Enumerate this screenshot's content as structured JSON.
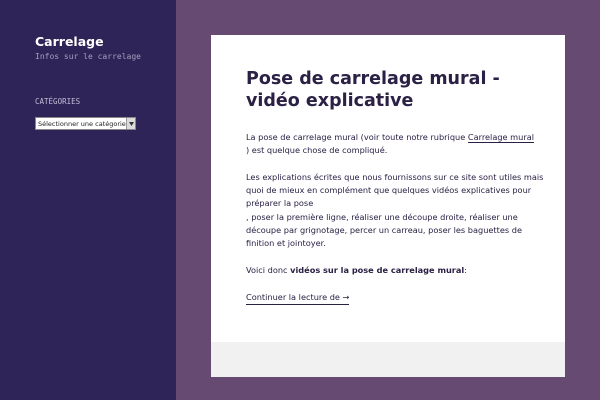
{
  "sidebar": {
    "site_title": "Carrelage",
    "site_description": "Infos sur le carrelage",
    "widget_title": "CATÉGORIES",
    "category_select_value": "Sélectionner une catégorie"
  },
  "article": {
    "title": "Pose de carrelage mural - vidéo explicative",
    "p1_before_link": "La pose de carrelage mural (voir toute notre rubrique ",
    "p1_link": "Carrelage mural",
    "p1_after_link": ") est quelque chose de compliqué.",
    "p2_line1": "Les explications écrites que nous fournissons sur ce site sont utiles mais quoi de mieux en complément que quelques vidéos explicatives pour préparer la pose",
    "p2_line2": ", poser la première ligne, réaliser une découpe droite, réaliser une découpe par grignotage, percer un carreau, poser les baguettes de finition et jointoyer.",
    "p3_before_bold": "Voici donc ",
    "p3_bold": "vidéos sur la pose de carrelage mural",
    "p3_after_bold": ":",
    "read_more": "Continuer la lecture de →"
  },
  "colors": {
    "sidebar_bg": "#2e2457",
    "page_bg": "#674a71",
    "text": "#2b2145"
  }
}
